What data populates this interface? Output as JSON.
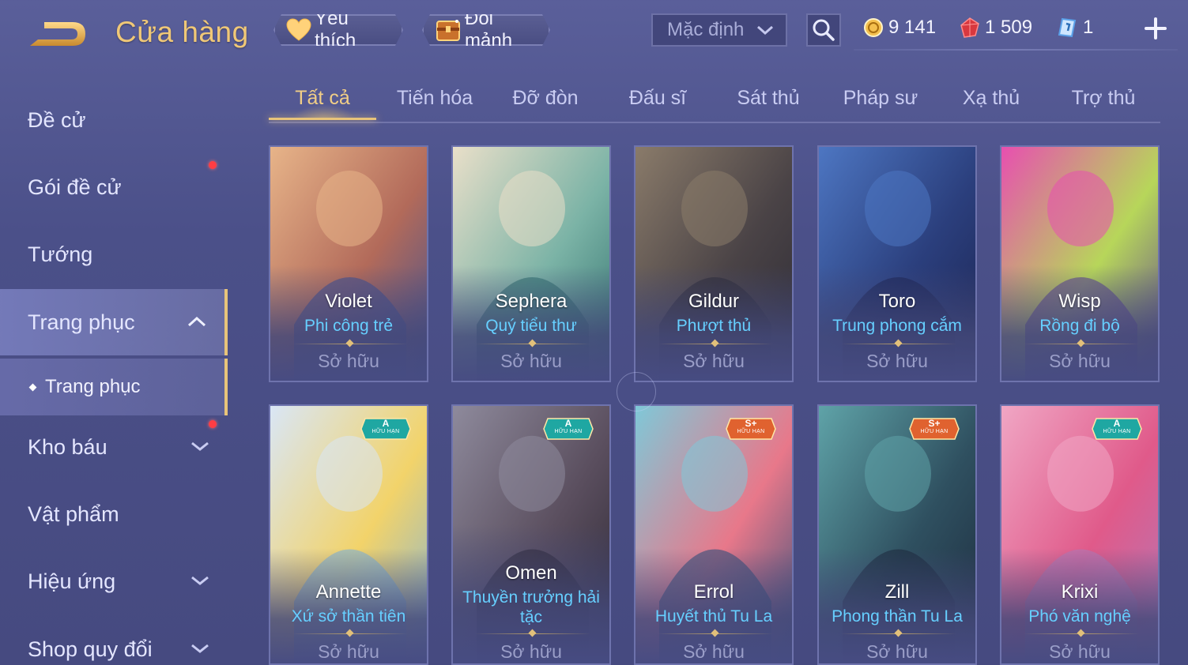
{
  "header": {
    "title": "Cửa hàng",
    "favorite_label": "Yêu thích",
    "exchange_label": "Đổi mảnh",
    "sort_value": "Mặc định",
    "currencies": [
      {
        "name": "gold-coin",
        "value": "9 141"
      },
      {
        "name": "ruby",
        "value": "1 509"
      },
      {
        "name": "ticket",
        "value": "1"
      }
    ]
  },
  "sidebar": {
    "items": [
      {
        "label": "Đề cử"
      },
      {
        "label": "Gói đề cử"
      },
      {
        "label": "Tướng"
      },
      {
        "label": "Trang phục"
      },
      {
        "label": "Trang phục"
      },
      {
        "label": "Kho báu"
      },
      {
        "label": "Vật phẩm"
      },
      {
        "label": "Hiệu ứng"
      },
      {
        "label": "Shop quy đổi"
      }
    ]
  },
  "tabs": [
    {
      "label": "Tất cả"
    },
    {
      "label": "Tiến hóa"
    },
    {
      "label": "Đỡ đòn"
    },
    {
      "label": "Đấu sĩ"
    },
    {
      "label": "Sát thủ"
    },
    {
      "label": "Pháp sư"
    },
    {
      "label": "Xạ thủ"
    },
    {
      "label": "Trợ thủ"
    }
  ],
  "cards": [
    {
      "hero": "Violet",
      "skin": "Phi công trẻ",
      "status": "Sở hữu",
      "palette": [
        "#e7b489",
        "#b26a5a",
        "#3b4f92"
      ]
    },
    {
      "hero": "Sephera",
      "skin": "Quý tiểu thư",
      "status": "Sở hữu",
      "palette": [
        "#e9dfc9",
        "#7bb3a6",
        "#2f6f6c"
      ]
    },
    {
      "hero": "Gildur",
      "skin": "Phượt thủ",
      "status": "Sở hữu",
      "palette": [
        "#8a7b6a",
        "#4a4346",
        "#2c2a34"
      ]
    },
    {
      "hero": "Toro",
      "skin": "Trung phong cắm",
      "status": "Sở hữu",
      "palette": [
        "#4d76c2",
        "#2b3f7d",
        "#1b2350"
      ]
    },
    {
      "hero": "Wisp",
      "skin": "Rồng đi bộ",
      "status": "Sở hữu",
      "palette": [
        "#e84fb0",
        "#b7d65a",
        "#5a3f93"
      ]
    },
    {
      "hero": "Annette",
      "skin": "Xứ sở thần tiên",
      "status": "Sở hữu",
      "badge": "A",
      "badge_sub": "HỮU HẠN",
      "palette": [
        "#d9e6f6",
        "#f2d36a",
        "#7fb2d9"
      ]
    },
    {
      "hero": "Omen",
      "skin": "Thuyền trưởng hải tặc",
      "status": "Sở hữu",
      "badge": "A",
      "badge_sub": "HỮU HẠN",
      "palette": [
        "#8e8a9c",
        "#5a4e5e",
        "#2a2530"
      ]
    },
    {
      "hero": "Errol",
      "skin": "Huyết thủ Tu La",
      "status": "Sở hữu",
      "badge": "S+",
      "badge_sub": "HỮU HẠN",
      "palette": [
        "#7fc8d8",
        "#e8788a",
        "#2e4f7a"
      ]
    },
    {
      "hero": "Zill",
      "skin": "Phong thần Tu La",
      "status": "Sở hữu",
      "badge": "S+",
      "badge_sub": "HỮU HẠN",
      "palette": [
        "#5fa3a8",
        "#2f5060",
        "#1c2a3c"
      ]
    },
    {
      "hero": "Krixi",
      "skin": "Phó văn nghệ",
      "status": "Sở hữu",
      "badge": "A",
      "badge_sub": "HỮU HẠN",
      "palette": [
        "#f0a6c4",
        "#e05a8a",
        "#b17ab8"
      ]
    }
  ],
  "colors": {
    "accent_gold": "#e8c47a",
    "skin_name_blue": "#66cfff",
    "badge_teal": "#1fa7a2",
    "badge_orange": "#e0622f",
    "notification_red": "#ff3d44"
  }
}
